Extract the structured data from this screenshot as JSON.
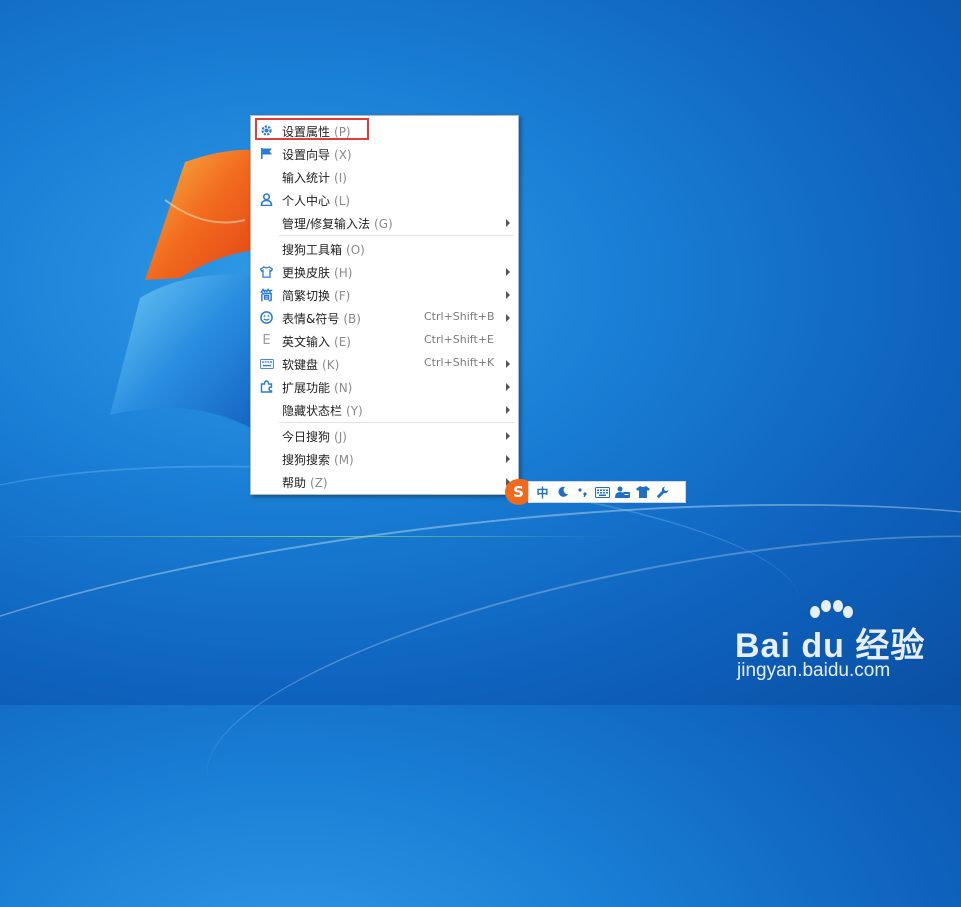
{
  "menu": {
    "items": [
      {
        "label": "设置属性",
        "key": "(P)",
        "icon": "gear-icon",
        "shortcut": "",
        "submenu": false
      },
      {
        "label": "设置向导",
        "key": "(X)",
        "icon": "flag-icon",
        "shortcut": "",
        "submenu": false
      },
      {
        "label": "输入统计",
        "key": "(I)",
        "icon": "",
        "shortcut": "",
        "submenu": false
      },
      {
        "label": "个人中心",
        "key": "(L)",
        "icon": "user-icon",
        "shortcut": "",
        "submenu": false
      },
      {
        "label": "管理/修复输入法",
        "key": "(G)",
        "icon": "",
        "shortcut": "",
        "submenu": true
      },
      {
        "label": "搜狗工具箱",
        "key": "(O)",
        "icon": "",
        "shortcut": "",
        "submenu": false
      },
      {
        "label": "更换皮肤",
        "key": "(H)",
        "icon": "shirt-icon",
        "shortcut": "",
        "submenu": true
      },
      {
        "label": "简繁切换",
        "key": "(F)",
        "icon": "jian-icon",
        "shortcut": "",
        "submenu": true
      },
      {
        "label": "表情&符号",
        "key": "(B)",
        "icon": "smiley-icon",
        "shortcut": "Ctrl+Shift+B",
        "submenu": true
      },
      {
        "label": "英文输入",
        "key": "(E)",
        "icon": "letter-e-icon",
        "shortcut": "Ctrl+Shift+E",
        "submenu": false
      },
      {
        "label": "软键盘",
        "key": "(K)",
        "icon": "keyboard-icon",
        "shortcut": "Ctrl+Shift+K",
        "submenu": true
      },
      {
        "label": "扩展功能",
        "key": "(N)",
        "icon": "puzzle-icon",
        "shortcut": "",
        "submenu": true
      },
      {
        "label": "隐藏状态栏",
        "key": "(Y)",
        "icon": "",
        "shortcut": "",
        "submenu": true
      },
      {
        "label": "今日搜狗",
        "key": "(J)",
        "icon": "",
        "shortcut": "",
        "submenu": true
      },
      {
        "label": "搜狗搜索",
        "key": "(M)",
        "icon": "",
        "shortcut": "",
        "submenu": true
      },
      {
        "label": "帮助",
        "key": "(Z)",
        "icon": "",
        "shortcut": "",
        "submenu": true
      }
    ],
    "icon_glyphs": {
      "jian": "简",
      "letter_e": "E"
    }
  },
  "statusbar": {
    "logo": "S",
    "mode": "中",
    "icons": [
      "logo-icon",
      "chinese-mode-icon",
      "moon-icon",
      "punctuation-icon",
      "keyboard-icon",
      "user-card-icon",
      "shirt-icon",
      "wrench-icon"
    ]
  },
  "watermark": {
    "brand": "Bai du 经验",
    "url": "jingyan.baidu.com"
  },
  "colors": {
    "desktop_blue": "#1a7fd6",
    "highlight": "#e03c3c",
    "icon_blue": "#2a7bd6",
    "sogou_orange": "#f06a1d"
  }
}
